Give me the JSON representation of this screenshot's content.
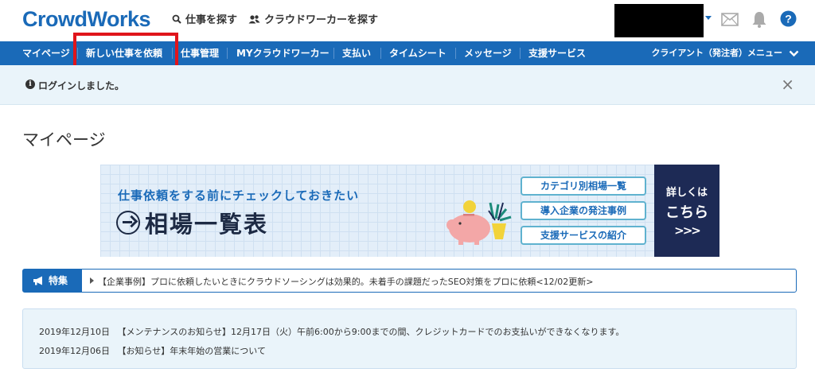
{
  "header": {
    "logo": "CrowdWorks",
    "find_jobs": "仕事を探す",
    "find_workers": "クラウドワーカーを探す",
    "icons": [
      "search-icon",
      "users-icon",
      "mail-icon",
      "bell-icon",
      "help-icon"
    ]
  },
  "nav": {
    "items": [
      {
        "label": "マイページ"
      },
      {
        "label": "新しい仕事を依頼"
      },
      {
        "label": "仕事管理"
      },
      {
        "label": "MYクラウドワーカー"
      },
      {
        "label": "支払い"
      },
      {
        "label": "タイムシート"
      },
      {
        "label": "メッセージ"
      },
      {
        "label": "支援サービス"
      }
    ],
    "client_menu": "クライアント（発注者）メニュー"
  },
  "alert": {
    "message": "ログインしました。",
    "close": "×"
  },
  "page_title": "マイページ",
  "banner": {
    "subtitle": "仕事依頼をする前にチェックしておきたい",
    "title": "相場一覧表",
    "pills": [
      "カテゴリ別相場一覧",
      "導入企業の発注事例",
      "支援サービスの紹介"
    ],
    "cta_line1": "詳しくは",
    "cta_line2": "こちら",
    "cta_arrows": ">>>"
  },
  "feature": {
    "tag": "特集",
    "text": "【企業事例】プロに依頼したいときにクラウドソーシングは効果的。未着手の課題だったSEO対策をプロに依頼<12/02更新>"
  },
  "notices": [
    {
      "date": "2019年12月10日",
      "text": "【メンテナンスのお知らせ】12月17日（火）午前6:00から9:00までの間、クレジットカードでのお支払いができなくなります。"
    },
    {
      "date": "2019年12月06日",
      "text": "【お知らせ】年末年始の営業について"
    }
  ],
  "colors": {
    "brand": "#1a6ab8",
    "highlight": "#e0151b",
    "alert_bg": "#eaf4fa",
    "banner_navy": "#1d2a55",
    "banner_yellow": "#f2d33a"
  }
}
